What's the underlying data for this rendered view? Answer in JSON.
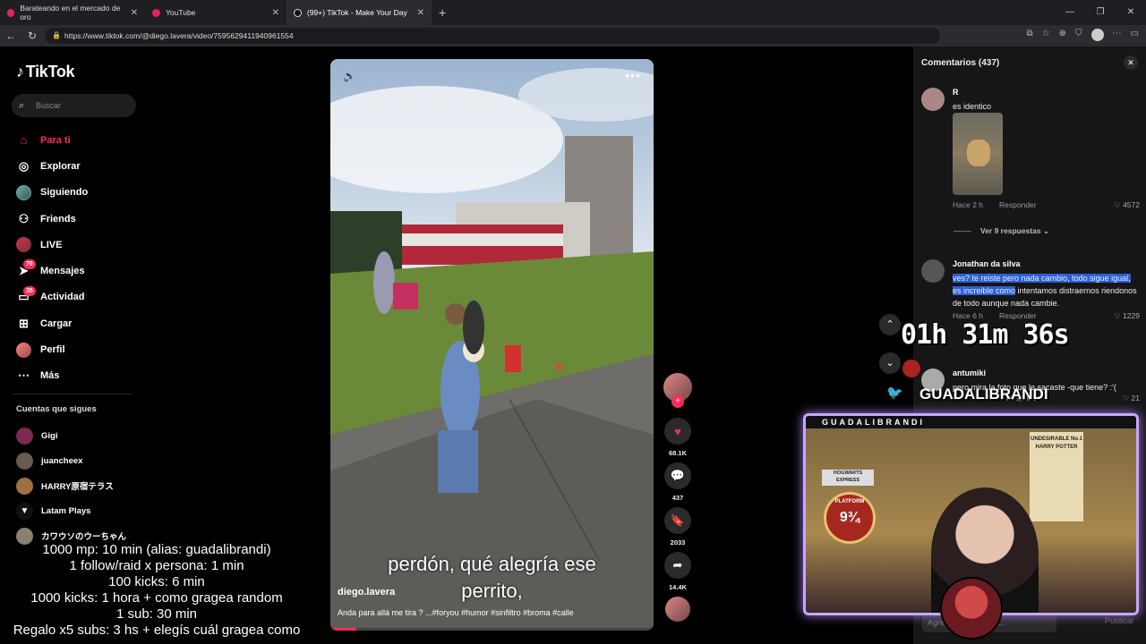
{
  "browser": {
    "tabs": [
      {
        "label": "Barateando en el mercado de oro"
      },
      {
        "label": "YouTube"
      },
      {
        "label": "(99+) TikTok - Make Your Day"
      }
    ],
    "url": "https://www.tiktok.com/@diego.lavera/video/7595629411940961554"
  },
  "sidebar": {
    "logo": "TikTok",
    "search_placeholder": "Buscar",
    "nav": [
      {
        "label": "Para ti",
        "icon": "home-icon"
      },
      {
        "label": "Explorar",
        "icon": "compass-icon"
      },
      {
        "label": "Siguiendo",
        "icon": "following-avatar-icon"
      },
      {
        "label": "Friends",
        "icon": "friends-icon"
      },
      {
        "label": "LIVE",
        "icon": "live-icon"
      },
      {
        "label": "Mensajes",
        "icon": "messages-icon",
        "badge": "79"
      },
      {
        "label": "Actividad",
        "icon": "activity-icon",
        "badge": "35"
      },
      {
        "label": "Cargar",
        "icon": "upload-icon"
      },
      {
        "label": "Perfil",
        "icon": "profile-icon"
      },
      {
        "label": "Más",
        "icon": "more-icon"
      }
    ],
    "following_title": "Cuentas que sigues",
    "following": [
      {
        "name": "Gigi"
      },
      {
        "name": "juancheex"
      },
      {
        "name": "HARRY原宿テラス"
      },
      {
        "name": "Latam Plays"
      },
      {
        "name": "カワウソのウーちゃん"
      }
    ]
  },
  "video": {
    "subtitle_line1": "perdón, qué alegría ese",
    "subtitle_line2": "perrito,",
    "author": "diego.lavera",
    "caption": "Anda para allá me tira ? ...#foryou #humor #sinfiltro #broma #calle",
    "progress": 0.08
  },
  "actions": {
    "likes": "68.1K",
    "comments": "437",
    "saves": "2033",
    "shares": "14.4K"
  },
  "comments_panel": {
    "title": "Comentarios (437)",
    "comments": [
      {
        "name": "R",
        "text": "es identico",
        "time": "Hace 2 h",
        "reply": "Responder",
        "likes": "4572"
      },
      {
        "name": "Jonathan da silva",
        "text_hl": "ves? te reiste pero nada cambio, todo sigue igual, es increible como",
        "text_rest": " intentamos distraernos riendonos de todo aunque nada cambie.",
        "time": "Hace 6 h",
        "reply": "Responder",
        "likes": "1229"
      },
      {
        "name": "antumiki",
        "text": "pero mira la foto que le sacaste -que tiene? :'(",
        "time": "",
        "reply": "Responder",
        "likes": "21"
      }
    ],
    "view_replies": "Ver 9 respuestas",
    "input_placeholder": "Agregar comentario...",
    "publish": "Publicar"
  },
  "overlay": {
    "timer": "01h 31m 36s",
    "handle": "GUADALIBRANDI",
    "cam_label": "GUADALIBRANDI",
    "poster_platform": "9¾",
    "poster_platform_text": "PLATFORM",
    "poster_hp": "UNDESIRABLE No.1 HARRY POTTER",
    "poster_hogwarts": "HOGWARTS EXPRESS",
    "rewards": [
      "1000 mp: 10 min (alias: guadalibrandi)",
      "1 follow/raid x persona: 1 min",
      "100 kicks: 6 min",
      "1000 kicks: 1 hora + como gragea random",
      "1 sub: 30 min",
      "Regalo x5 subs: 3 hs + elegís cuál gragea como"
    ]
  }
}
